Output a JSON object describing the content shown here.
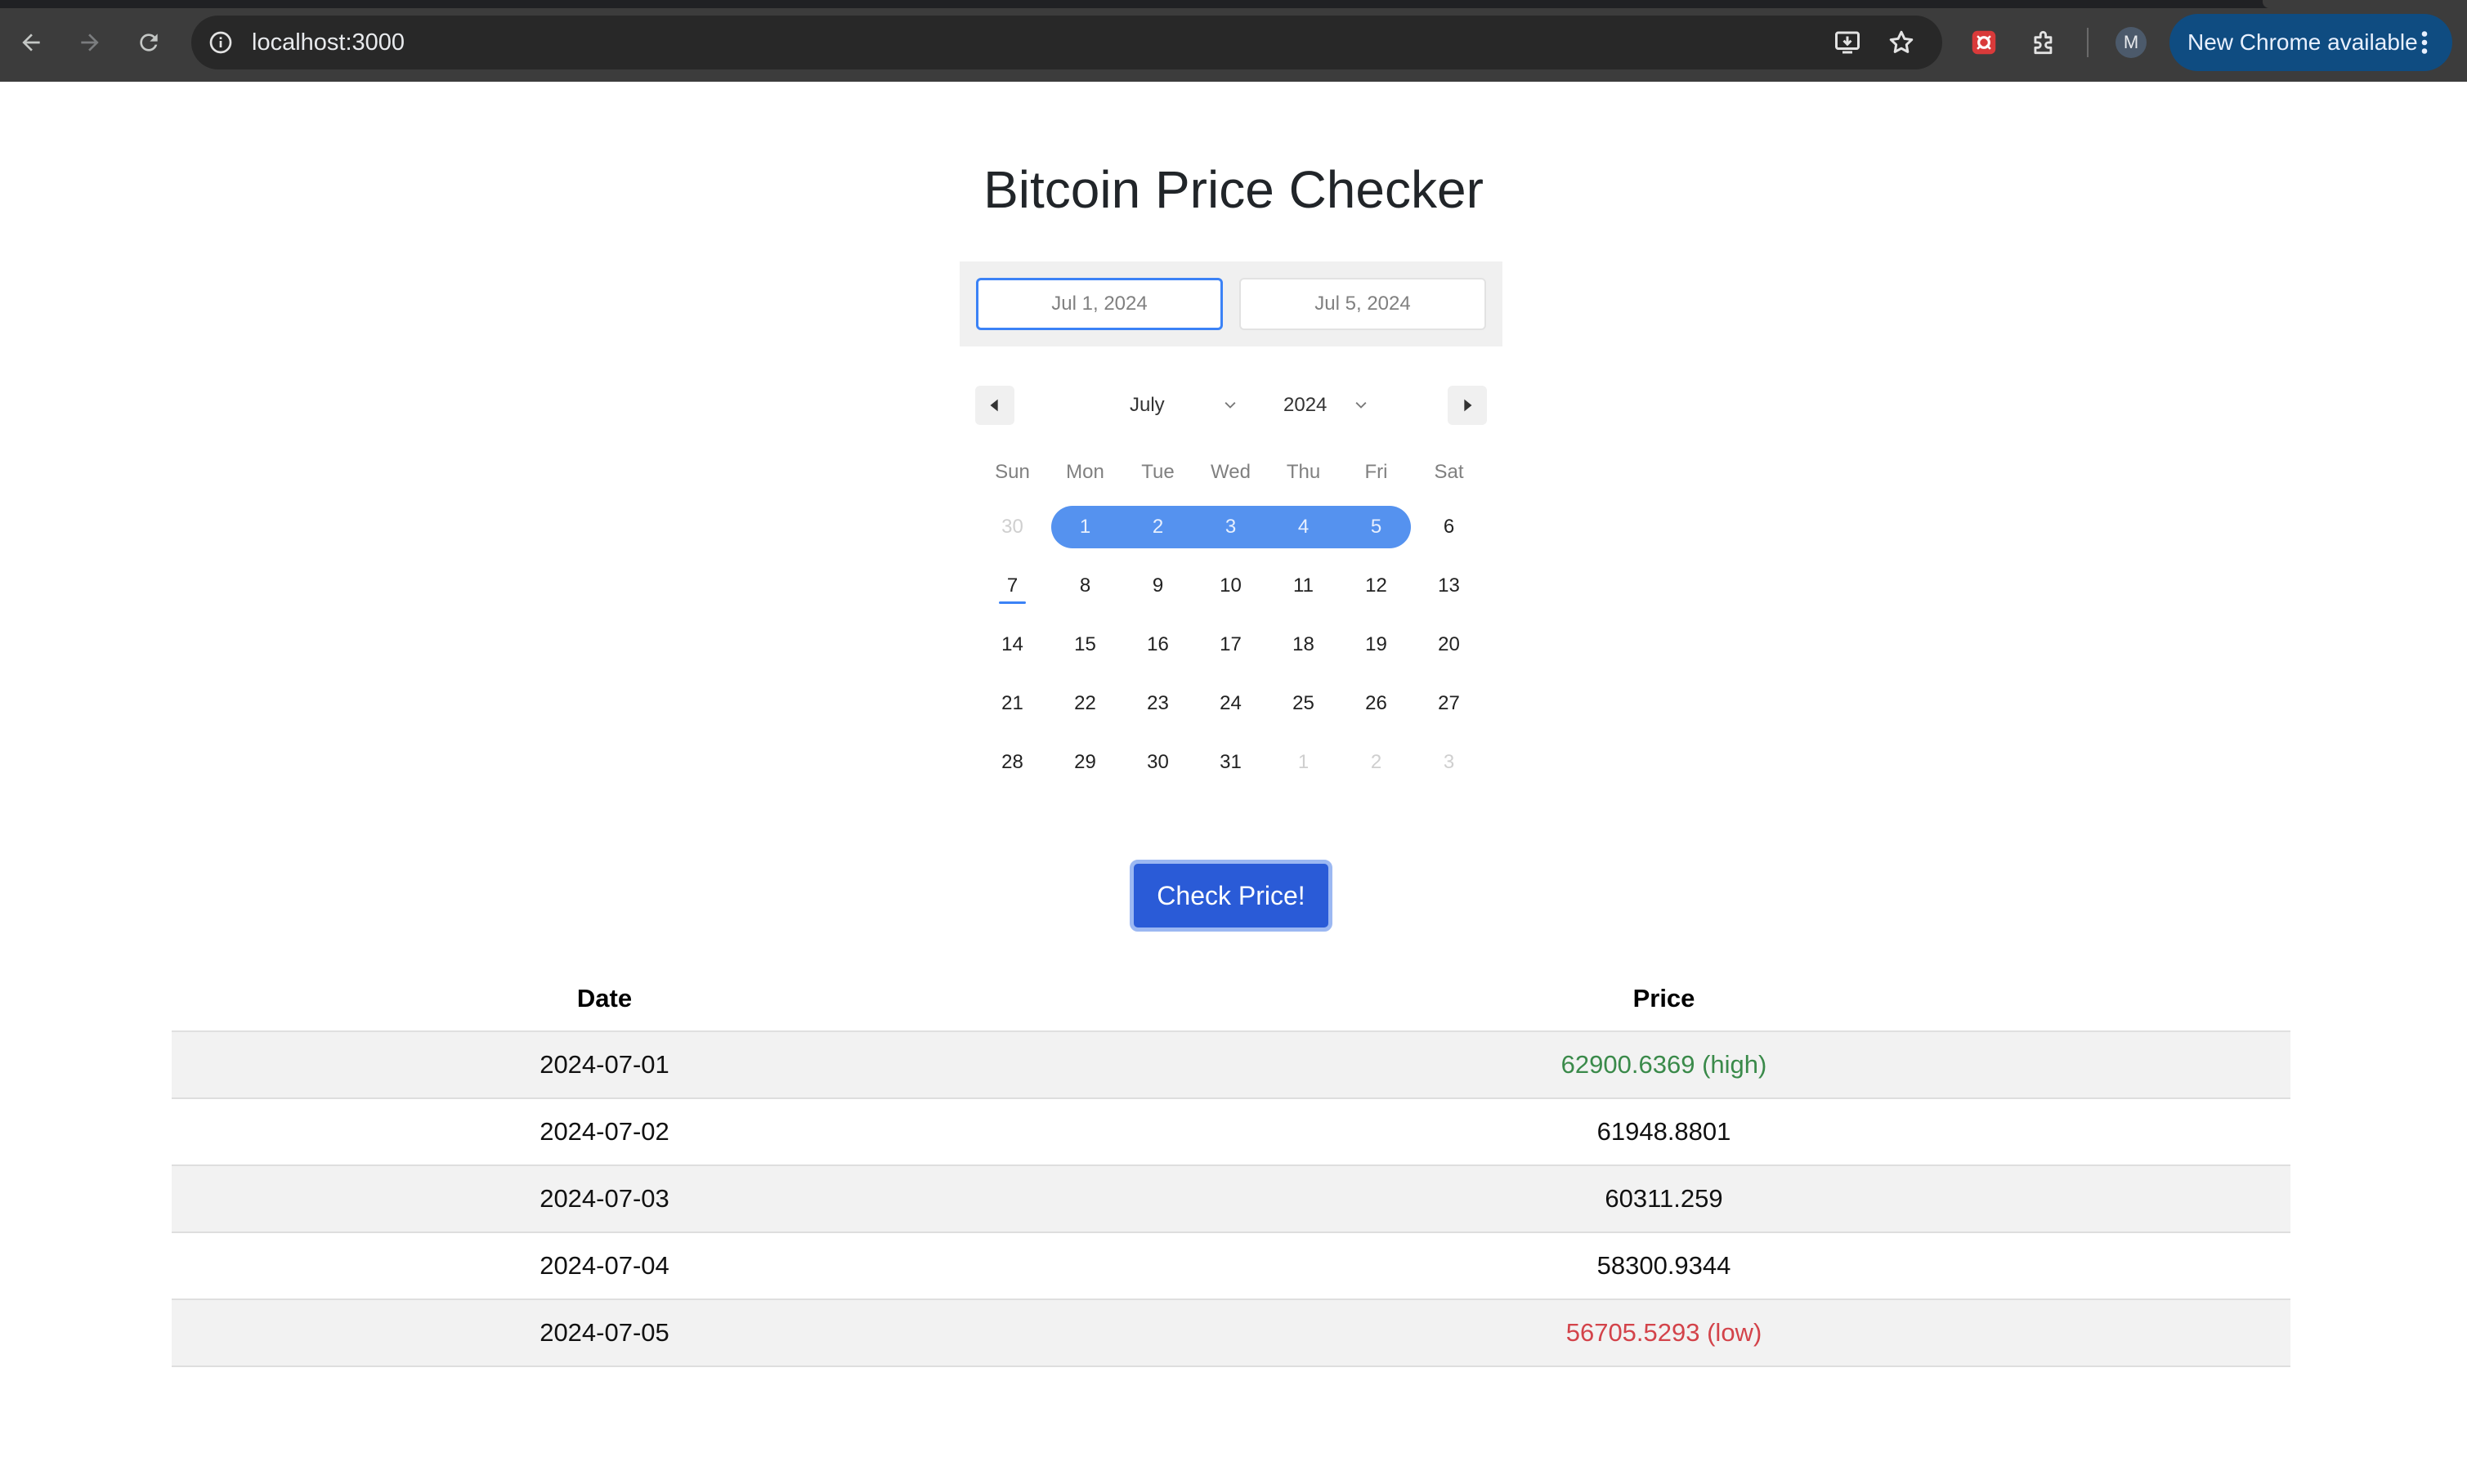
{
  "browser": {
    "url": "localhost:3000",
    "avatar_letter": "M",
    "update_label": "New Chrome available",
    "colors": {
      "frame": "#3c3c3c",
      "omnibox": "#282828",
      "update_pill": "#0f4c81"
    },
    "icons": [
      "back-arrow-icon",
      "forward-arrow-icon",
      "reload-icon",
      "site-info-icon",
      "install-app-icon",
      "bookmark-star-icon",
      "extension-red-icon",
      "extensions-puzzle-icon",
      "kebab-menu-icon"
    ]
  },
  "page": {
    "title": "Bitcoin Price Checker"
  },
  "date_range": {
    "start": "Jul 1, 2024",
    "end": "Jul 5, 2024"
  },
  "calendar": {
    "month": "July",
    "year": "2024",
    "weekdays": [
      "Sun",
      "Mon",
      "Tue",
      "Wed",
      "Thu",
      "Fri",
      "Sat"
    ],
    "weeks": [
      [
        "30",
        "1",
        "2",
        "3",
        "4",
        "5",
        "6"
      ],
      [
        "7",
        "8",
        "9",
        "10",
        "11",
        "12",
        "13"
      ],
      [
        "14",
        "15",
        "16",
        "17",
        "18",
        "19",
        "20"
      ],
      [
        "21",
        "22",
        "23",
        "24",
        "25",
        "26",
        "27"
      ],
      [
        "28",
        "29",
        "30",
        "31",
        "1",
        "2",
        "3"
      ]
    ],
    "today": "7",
    "selected_range": [
      "1",
      "5"
    ],
    "colors": {
      "range": "#5592ef",
      "today_underline": "#3b82f6"
    }
  },
  "action": {
    "check_label": "Check Price!",
    "color": "#2a5bd7"
  },
  "results": {
    "headers": {
      "date": "Date",
      "price": "Price"
    },
    "rows": [
      {
        "date": "2024-07-01",
        "price": "62900.6369 (high)"
      },
      {
        "date": "2024-07-02",
        "price": "61948.8801"
      },
      {
        "date": "2024-07-03",
        "price": "60311.259"
      },
      {
        "date": "2024-07-04",
        "price": "58300.9344"
      },
      {
        "date": "2024-07-05",
        "price": "56705.5293 (low)"
      }
    ],
    "colors": {
      "high": "#3a8a4a",
      "low": "#d3434a"
    }
  }
}
